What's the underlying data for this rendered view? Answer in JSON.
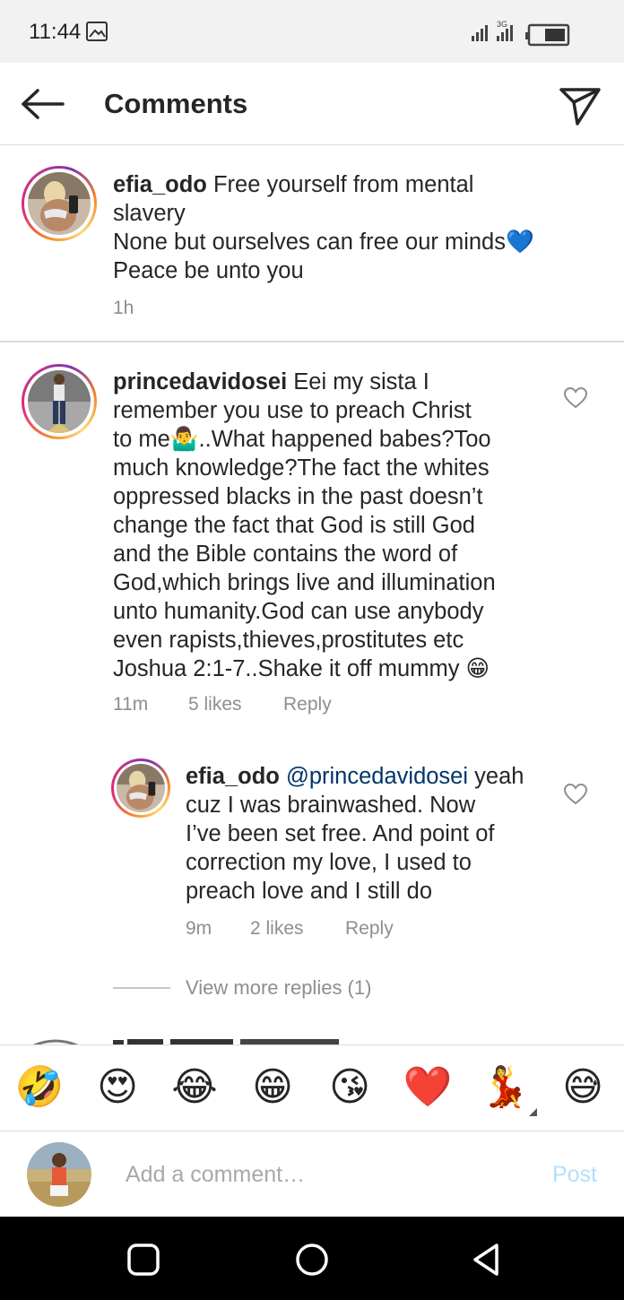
{
  "status_bar": {
    "time": "11:44",
    "network": "3G"
  },
  "header": {
    "title": "Comments"
  },
  "comments": [
    {
      "username": "efia_odo",
      "text_lines": [
        "Free yourself from mental",
        "slavery",
        "None but ourselves can free our minds💙",
        "Peace be unto you"
      ],
      "time": "1h"
    },
    {
      "username": "princedavidosei",
      "text_lines": [
        "Eei my sista I",
        "remember you use to preach Christ",
        "to me🤷‍♂️..What happened babes?Too",
        "much knowledge?The fact the whites",
        "oppressed blacks in the past doesn’t",
        "change the fact that God is still God",
        "and the Bible contains the word of",
        "God,which brings live and illumination",
        "unto humanity.God can use anybody",
        "even rapists,thieves,prostitutes etc",
        "Joshua 2:1-7..Shake it off mummy 😁"
      ],
      "time": "11m",
      "likes": "5 likes",
      "reply": "Reply"
    }
  ],
  "reply": {
    "username": "efia_odo",
    "mention": "@princedavidosei",
    "text_lines": [
      "yeah",
      "cuz I was brainwashed. Now",
      "I’ve been set free. And point of",
      "correction my love, I used to",
      "preach love and I still do"
    ],
    "time": "9m",
    "likes": "2 likes",
    "reply": "Reply"
  },
  "view_more": "View more replies (1)",
  "emoji_bar": [
    "🤣",
    "😍",
    "😂",
    "😁",
    "😘",
    "❤️",
    "💃",
    "😅"
  ],
  "input": {
    "placeholder": "Add a comment…",
    "post_label": "Post"
  },
  "colors": {
    "post_disabled": "#b2dffc",
    "mention": "#003569",
    "meta": "#8e8e8e"
  }
}
